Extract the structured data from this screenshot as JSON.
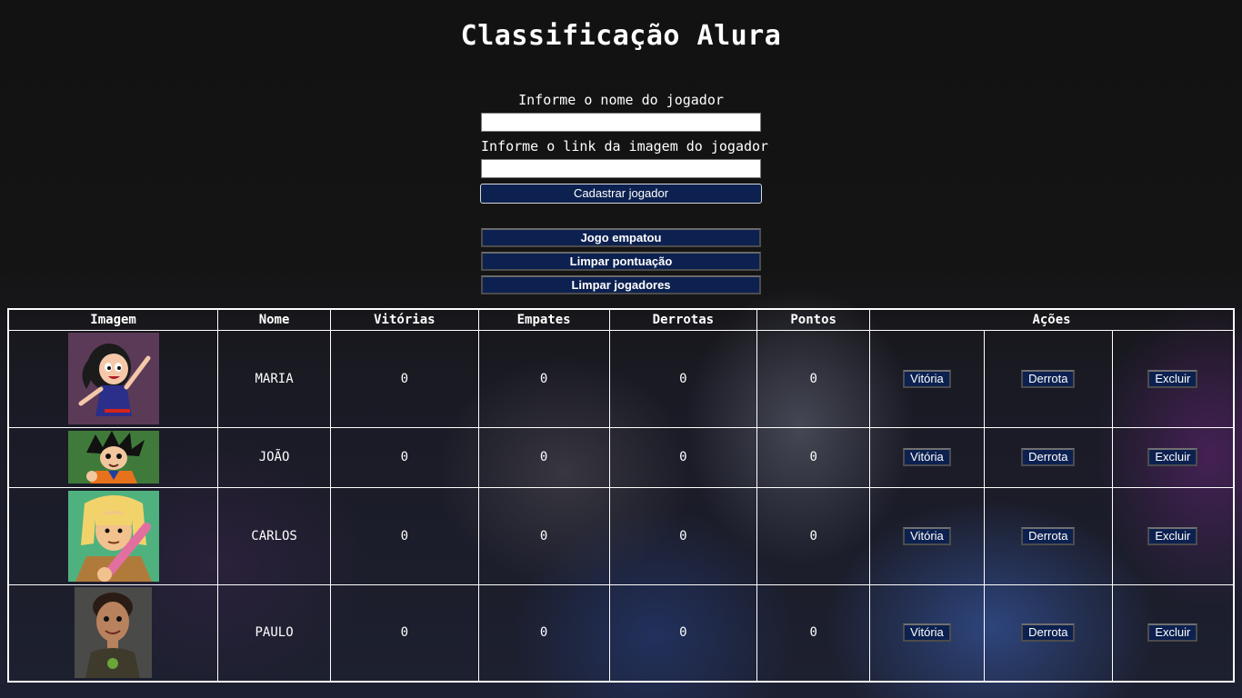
{
  "title": "Classificação Alura",
  "form": {
    "name_label": "Informe o nome do jogador",
    "name_value": "",
    "image_label": "Informe o link da imagem do jogador",
    "image_value": "",
    "submit_label": "Cadastrar jogador"
  },
  "actions": {
    "draw_label": "Jogo empatou",
    "clear_score_label": "Limpar pontuação",
    "clear_players_label": "Limpar jogadores"
  },
  "table": {
    "headers": [
      "Imagem",
      "Nome",
      "Vitórias",
      "Empates",
      "Derrotas",
      "Pontos",
      "Ações"
    ],
    "win_label": "Vitória",
    "loss_label": "Derrota",
    "delete_label": "Excluir",
    "rows": [
      {
        "avatar": "cartoon-girl-avatar",
        "name": "MARIA",
        "wins": "0",
        "draws": "0",
        "losses": "0",
        "points": "0"
      },
      {
        "avatar": "cartoon-boy-avatar",
        "name": "JOÃO",
        "wins": "0",
        "draws": "0",
        "losses": "0",
        "points": "0"
      },
      {
        "avatar": "cartoon-hero-avatar",
        "name": "CARLOS",
        "wins": "0",
        "draws": "0",
        "losses": "0",
        "points": "0"
      },
      {
        "avatar": "3d-boy-avatar",
        "name": "PAULO",
        "wins": "0",
        "draws": "0",
        "losses": "0",
        "points": "0"
      }
    ]
  },
  "colors": {
    "button_bg": "#0c2150",
    "page_bg": "#121212",
    "text": "#ffffff"
  }
}
